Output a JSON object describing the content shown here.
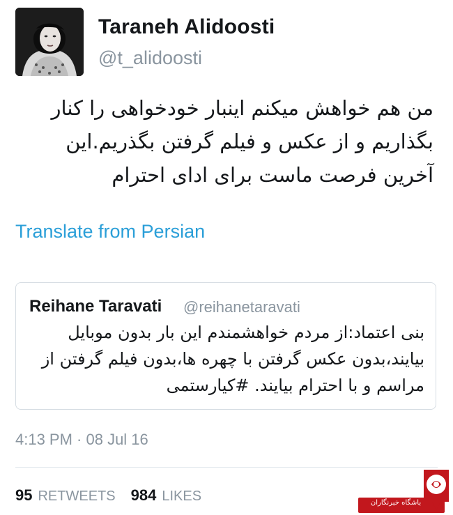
{
  "author": {
    "display_name": "Taraneh Alidoosti",
    "handle": "@t_alidoosti",
    "avatar_icon": "profile-photo"
  },
  "tweet": {
    "lines": [
      "من هم خواهش میکنم اینبار خودخواهی را کنار",
      "بگذاریم  و از عکس و فیلم گرفتن بگذریم.این",
      "آخرین فرصت ماست برای ادای احترام"
    ],
    "translate_label": "Translate from Persian",
    "timestamp": "4:13 PM · 08 Jul 16"
  },
  "quoted_tweet": {
    "display_name": "Reihane Taravati",
    "handle": "@reihanetaravati",
    "lines": [
      "بنی اعتماد:از مردم خواهشمندم این بار بدون موبایل",
      "بیایند،بدون عکس گرفتن با چهره ها،بدون فیلم گرفتن از",
      "مراسم و با احترام بیایند. #کیارستمی"
    ]
  },
  "stats": {
    "retweets_count": "95",
    "retweets_label": "RETWEETS",
    "likes_count": "984",
    "likes_label": "LIKES"
  },
  "watermark": {
    "text": "باشگاه خبرنگاران",
    "color": "#c2171d"
  },
  "colors": {
    "link": "#2b9fd8",
    "muted": "#8a959f",
    "text": "#14171a",
    "border": "#d6dde3"
  }
}
